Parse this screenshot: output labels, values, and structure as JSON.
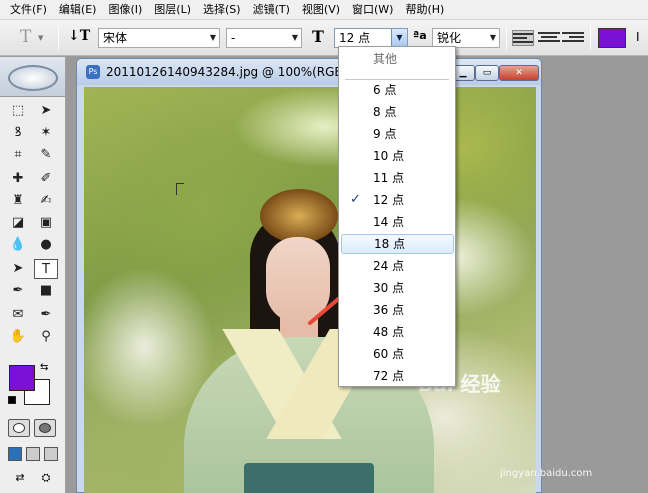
{
  "menu": [
    "文件(F)",
    "编辑(E)",
    "图像(I)",
    "图层(L)",
    "选择(S)",
    "滤镜(T)",
    "视图(V)",
    "窗口(W)",
    "帮助(H)"
  ],
  "options": {
    "tool_glyph": "T",
    "orient_glyph": "↓T",
    "font_family": "宋体",
    "font_style": "-",
    "size_glyph": "T",
    "font_size": "12 点",
    "aa_glyph": "ªa",
    "antialias": "锐化",
    "text_color": "#7B10D8"
  },
  "document": {
    "title": "20110126140943284.jpg @ 100%(RGB)",
    "ps_glyph": "Ps",
    "minimize_glyph": "▁",
    "maximize_glyph": "▭",
    "close_glyph": "✕"
  },
  "size_dropdown": {
    "header": "其他",
    "items": [
      "6 点",
      "8 点",
      "9 点",
      "10 点",
      "11 点",
      "12 点",
      "14 点",
      "18 点",
      "24 点",
      "30 点",
      "36 点",
      "48 点",
      "60 点",
      "72 点"
    ],
    "checked": "12 点",
    "hovered": "18 点",
    "check_glyph": "✓"
  },
  "toolbox": {
    "foreground_color": "#7B10D8",
    "background_color": "#FFFFFF"
  },
  "watermark": {
    "brand": "Bai 经验",
    "url": "jingyan.baidu.com"
  }
}
